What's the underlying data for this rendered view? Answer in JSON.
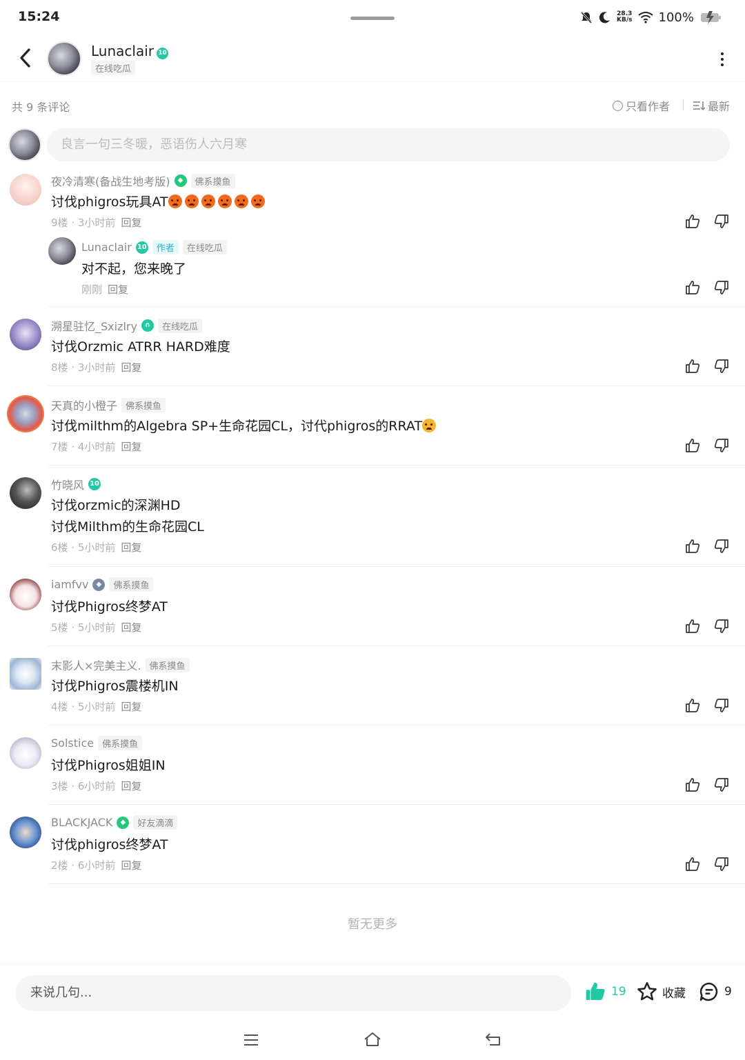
{
  "status_bar": {
    "time": "15:24",
    "net_speed_value": "28.3",
    "net_speed_unit": "KB/s",
    "battery": "100%"
  },
  "header": {
    "author_name": "Lunaclair",
    "author_level": "10",
    "author_tag": "在线吃瓜"
  },
  "comments_bar": {
    "count_text": "共 9 条评论",
    "author_only": "只看作者",
    "sort": "最新"
  },
  "input": {
    "placeholder": "良言一句三冬暖，恶语伤人六月寒"
  },
  "comments": [
    {
      "user": "夜冷清寒(备战生地考版)",
      "tag": "佛系摸鱼",
      "text": "讨伐phigros玩具AT",
      "floor": "9楼",
      "time": "3小时前",
      "reply": "回复"
    },
    {
      "user": "溯星驻忆_Sxizlry",
      "tag": "在线吃瓜",
      "text": "讨伐Orzmic ATRR HARD难度",
      "floor": "8楼",
      "time": "3小时前",
      "reply": "回复"
    },
    {
      "user": "天真的小橙子",
      "tag": "佛系摸鱼",
      "text": "讨伐milthm的Algebra SP+生命花园CL，讨代phigros的RRAT",
      "floor": "7楼",
      "time": "4小时前",
      "reply": "回复"
    },
    {
      "user": "竹晓风",
      "level": "10",
      "text": "讨伐orzmic的深渊HD",
      "text2": "讨伐Milthm的生命花园CL",
      "floor": "6楼",
      "time": "5小时前",
      "reply": "回复"
    },
    {
      "user": "iamfvv",
      "tag": "佛系摸鱼",
      "text": "讨伐Phigros终梦AT",
      "floor": "5楼",
      "time": "5小时前",
      "reply": "回复"
    },
    {
      "user": "末影人×完美主义.",
      "tag": "佛系摸鱼",
      "text": "讨伐Phigros震楼机IN",
      "floor": "4楼",
      "time": "5小时前",
      "reply": "回复"
    },
    {
      "user": "Solstice",
      "tag": "佛系摸鱼",
      "text": "讨伐Phigros姐姐IN",
      "floor": "3楼",
      "time": "6小时前",
      "reply": "回复"
    },
    {
      "user": "BLACKJACK",
      "tag": "好友滴滴",
      "text": "讨伐phigros终梦AT",
      "floor": "2楼",
      "time": "6小时前",
      "reply": "回复"
    }
  ],
  "sub_reply": {
    "user": "Lunaclair",
    "level": "10",
    "author_tag": "作者",
    "tag": "在线吃瓜",
    "text": "对不起，您来晚了",
    "time": "刚刚",
    "reply": "回复"
  },
  "footer_text": "暂无更多",
  "bottom": {
    "placeholder": "来说几句...",
    "likes": "19",
    "favorite": "收藏",
    "comments": "9"
  },
  "colors": {
    "accent": "#22c9a5",
    "text": "#1a1a1a",
    "muted": "#8a8a8a"
  }
}
